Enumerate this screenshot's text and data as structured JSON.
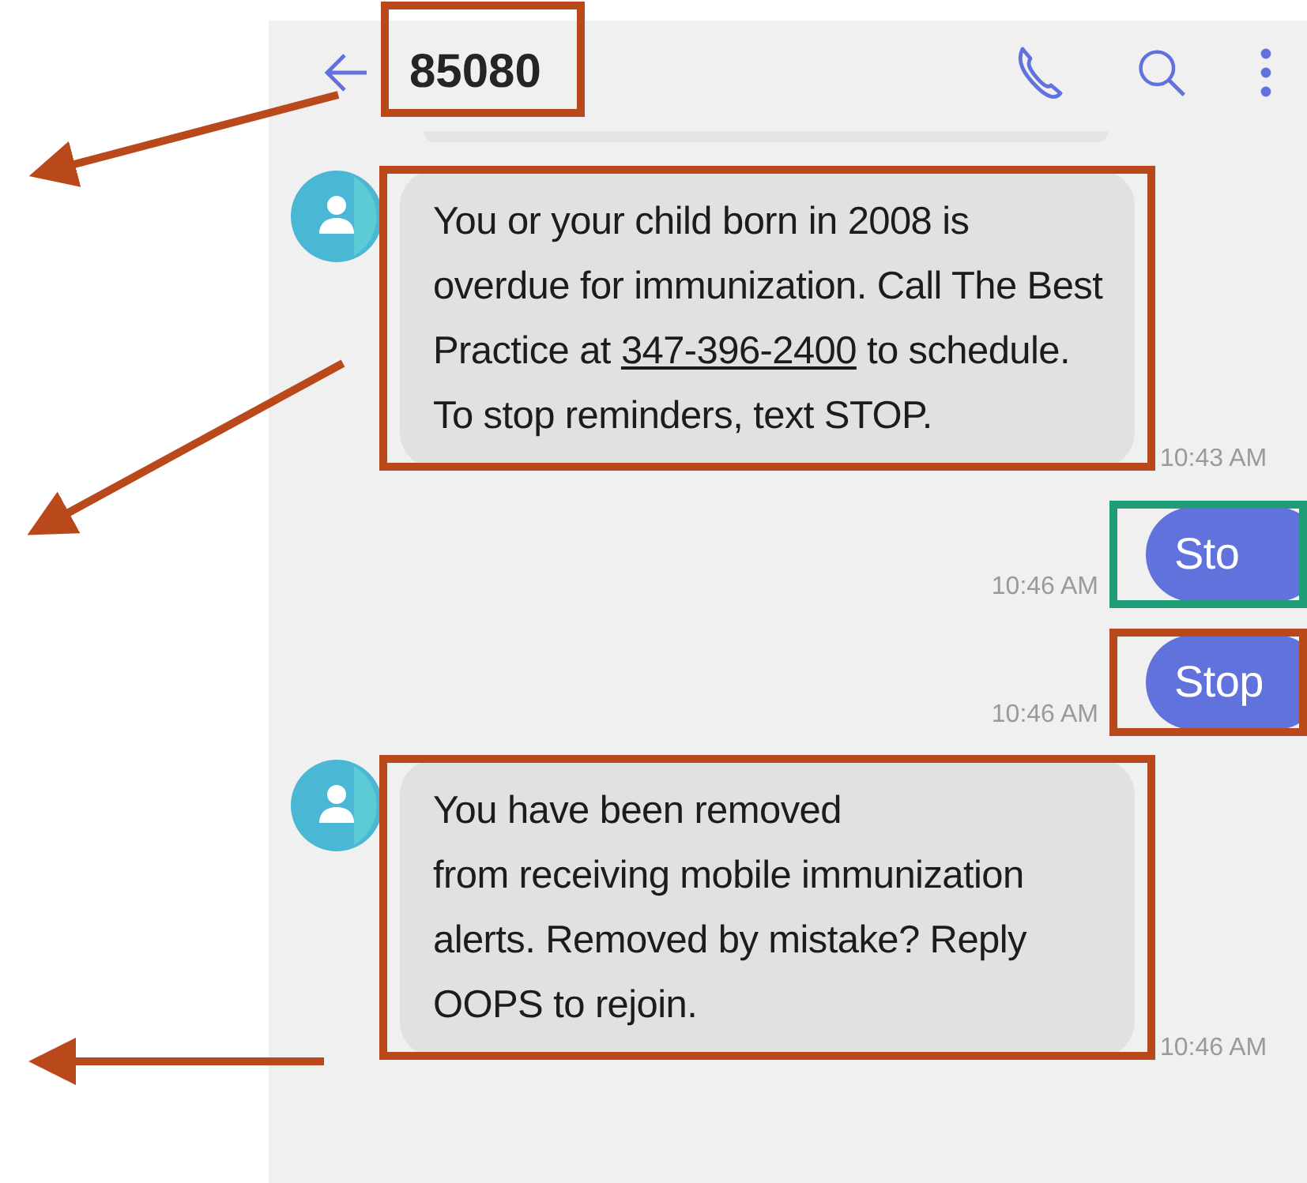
{
  "header": {
    "title": "85080",
    "color": "#b9481b"
  },
  "messages": [
    {
      "kind": "incoming",
      "segments": [
        {
          "kind": "plain",
          "text": "You or your child born in 2008 is overdue for immunization. Call The Best Practice at "
        },
        {
          "kind": "link",
          "text": "347-396-2400"
        },
        {
          "kind": "plain",
          "text": " to schedule. To stop reminders, text STOP."
        }
      ],
      "time": "10:43 AM",
      "color": "#b9481b"
    },
    {
      "kind": "outgoing",
      "segments": [
        {
          "kind": "plain",
          "text": "Sto"
        }
      ],
      "time": "10:46 AM",
      "color": "#1f9c78"
    },
    {
      "kind": "outgoing",
      "segments": [
        {
          "kind": "plain",
          "text": "Stop"
        }
      ],
      "time": "10:46 AM",
      "color": "#b9481b"
    },
    {
      "kind": "incoming",
      "segments": [
        {
          "kind": "plain",
          "text": "You have been removed\nfrom receiving mobile immunization alerts. Removed by mistake? Reply OOPS to rejoin."
        }
      ],
      "time": "10:46 AM",
      "color": "#b9481b"
    }
  ]
}
